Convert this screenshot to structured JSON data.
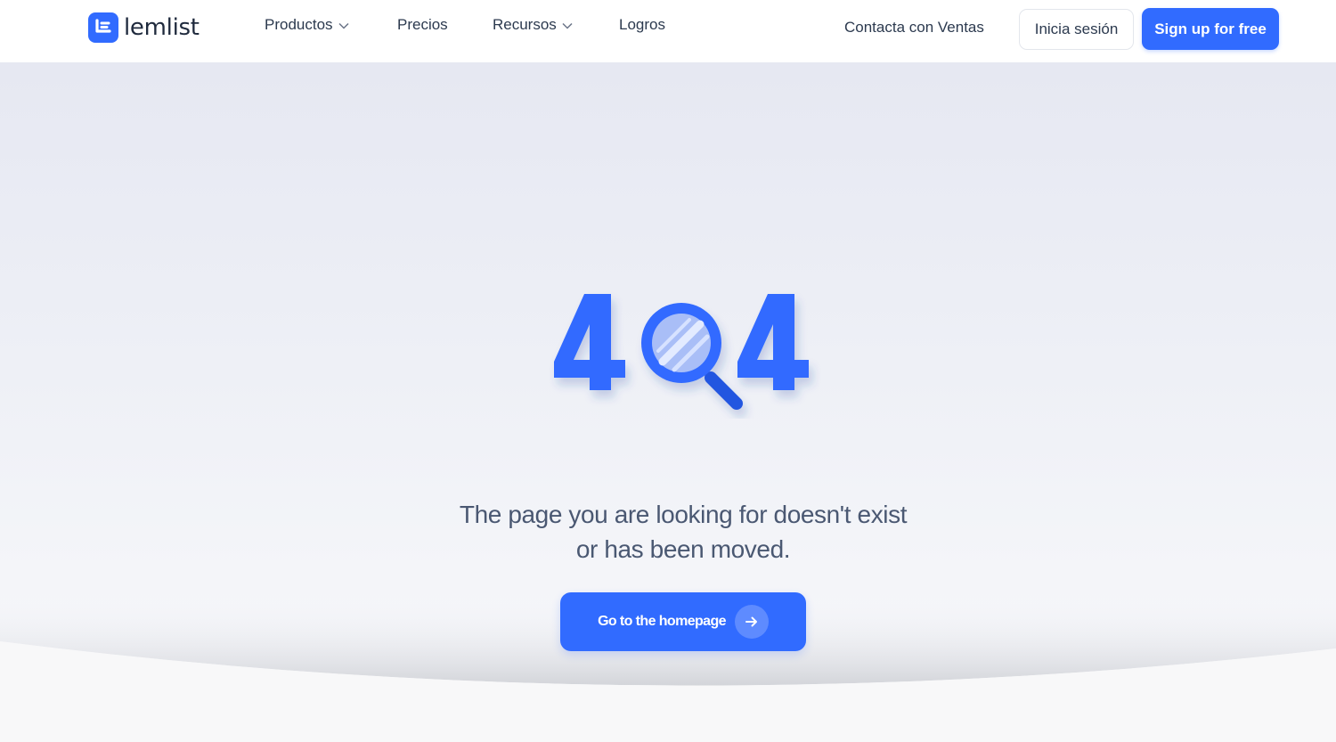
{
  "brand": {
    "name": "lemlist",
    "accent": "#316bff"
  },
  "nav": {
    "items": [
      {
        "label": "Productos",
        "has_dropdown": true
      },
      {
        "label": "Precios",
        "has_dropdown": false
      },
      {
        "label": "Recursos",
        "has_dropdown": true
      },
      {
        "label": "Logros",
        "has_dropdown": false
      }
    ],
    "contact_label": "Contacta con Ventas",
    "login_label": "Inicia sesión",
    "signup_label": "Sign up for free"
  },
  "error": {
    "code": "404",
    "message_line1": "The page you are looking for doesn't exist",
    "message_line2": "or has been moved.",
    "cta_label": "Go to the homepage",
    "cta_icon": "arrow-right-icon"
  }
}
